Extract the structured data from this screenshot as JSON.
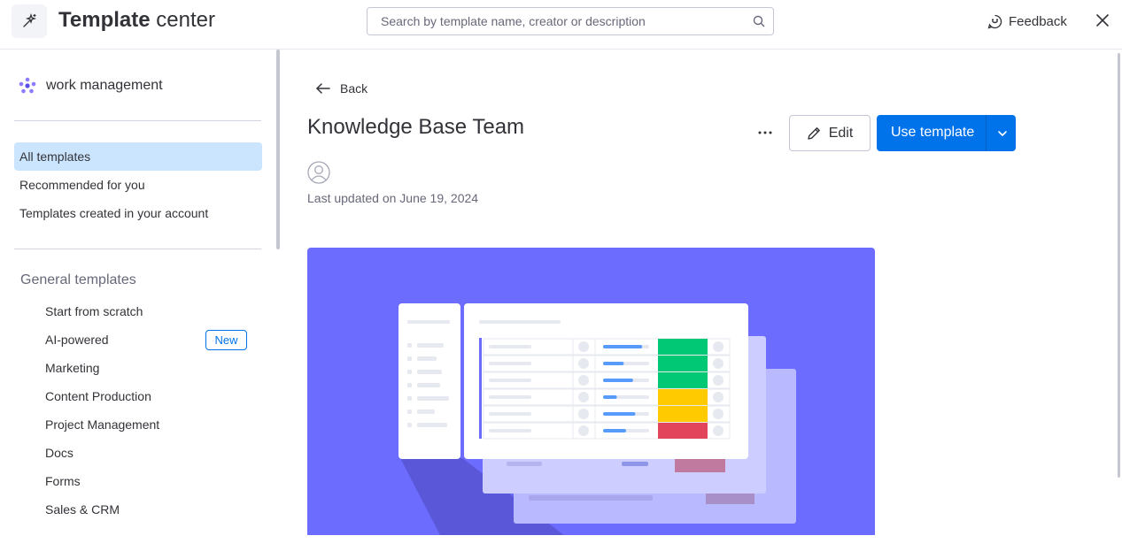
{
  "header": {
    "title_bold": "Template",
    "title_rest": " center",
    "app_icon": "magic-wand-icon",
    "search_placeholder": "Search by template name, creator or description",
    "feedback_label": "Feedback",
    "close_icon": "close-icon"
  },
  "sidebar": {
    "workspace_name": "work management",
    "nav": [
      {
        "label": "All templates",
        "active": true
      },
      {
        "label": "Recommended for you",
        "active": false
      },
      {
        "label": "Templates created in your account",
        "active": false
      }
    ],
    "section_title": "General templates",
    "categories": [
      {
        "label": "Start from scratch"
      },
      {
        "label": "AI-powered",
        "badge": "New"
      },
      {
        "label": "Marketing"
      },
      {
        "label": "Content Production"
      },
      {
        "label": "Project Management"
      },
      {
        "label": "Docs"
      },
      {
        "label": "Forms"
      },
      {
        "label": "Sales & CRM"
      }
    ]
  },
  "main": {
    "back_label": "Back",
    "template_title": "Knowledge Base Team",
    "more_label": "···",
    "edit_label": "Edit",
    "use_label": "Use template",
    "last_updated": "Last updated on June 19, 2024"
  },
  "colors": {
    "accent": "#0073ea",
    "active_nav": "#cce5ff",
    "preview_bg": "#6c6cff",
    "status_green": "#00c875",
    "status_yellow": "#ffcb00",
    "status_red": "#e2445c"
  },
  "preview_rows": [
    {
      "progress": 0.85,
      "status": "green"
    },
    {
      "progress": 0.45,
      "status": "green"
    },
    {
      "progress": 0.65,
      "status": "green"
    },
    {
      "progress": 0.3,
      "status": "yellow"
    },
    {
      "progress": 0.7,
      "status": "yellow"
    },
    {
      "progress": 0.5,
      "status": "red"
    }
  ]
}
